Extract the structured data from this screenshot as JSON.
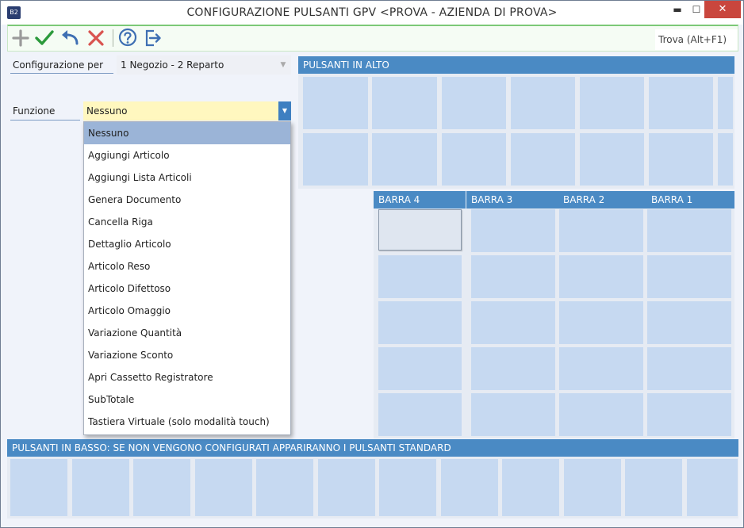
{
  "window": {
    "title": "CONFIGURAZIONE PULSANTI GPV <PROVA - AZIENDA DI PROVA>",
    "app_icon_text": "B2"
  },
  "titlebar_buttons": {
    "minimize": "▬",
    "maximize": "☐",
    "close": "✕"
  },
  "toolbar": {
    "search_label": "Trova (Alt+F1)",
    "colors": {
      "add": "#9a9a9a",
      "confirm": "#2c9a3c",
      "undo": "#3e6fb3",
      "cancel": "#d9534f",
      "help": "#3e6fb3",
      "exit": "#3e6fb3"
    }
  },
  "form": {
    "config_label": "Configurazione per",
    "config_value": "1 Negozio - 2 Reparto",
    "function_label": "Funzione",
    "function_value": "Nessuno"
  },
  "dropdown": {
    "options": [
      "Nessuno",
      "Aggiungi Articolo",
      "Aggiungi Lista Articoli",
      "Genera Documento",
      "Cancella Riga",
      "Dettaglio Articolo",
      "Articolo Reso",
      "Articolo Difettoso",
      "Articolo Omaggio",
      "Variazione Quantità",
      "Variazione Sconto",
      "Apri Cassetto Registratore",
      "SubTotale",
      "Tastiera Virtuale (solo modalità touch)"
    ],
    "selected_index": 0
  },
  "panels": {
    "top_header": "PULSANTI IN ALTO",
    "bars": [
      "BARRA 4",
      "BARRA 3",
      "BARRA 2",
      "BARRA 1"
    ],
    "bottom_header": "PULSANTI IN BASSO: SE NON VENGONO CONFIGURATI APPARIRANNO I PULSANTI STANDARD"
  },
  "colors": {
    "header": "#4a8ac4",
    "tile": "#c6d9f1",
    "selected_option": "#9bb4d7",
    "function_field": "#fff7bf"
  }
}
